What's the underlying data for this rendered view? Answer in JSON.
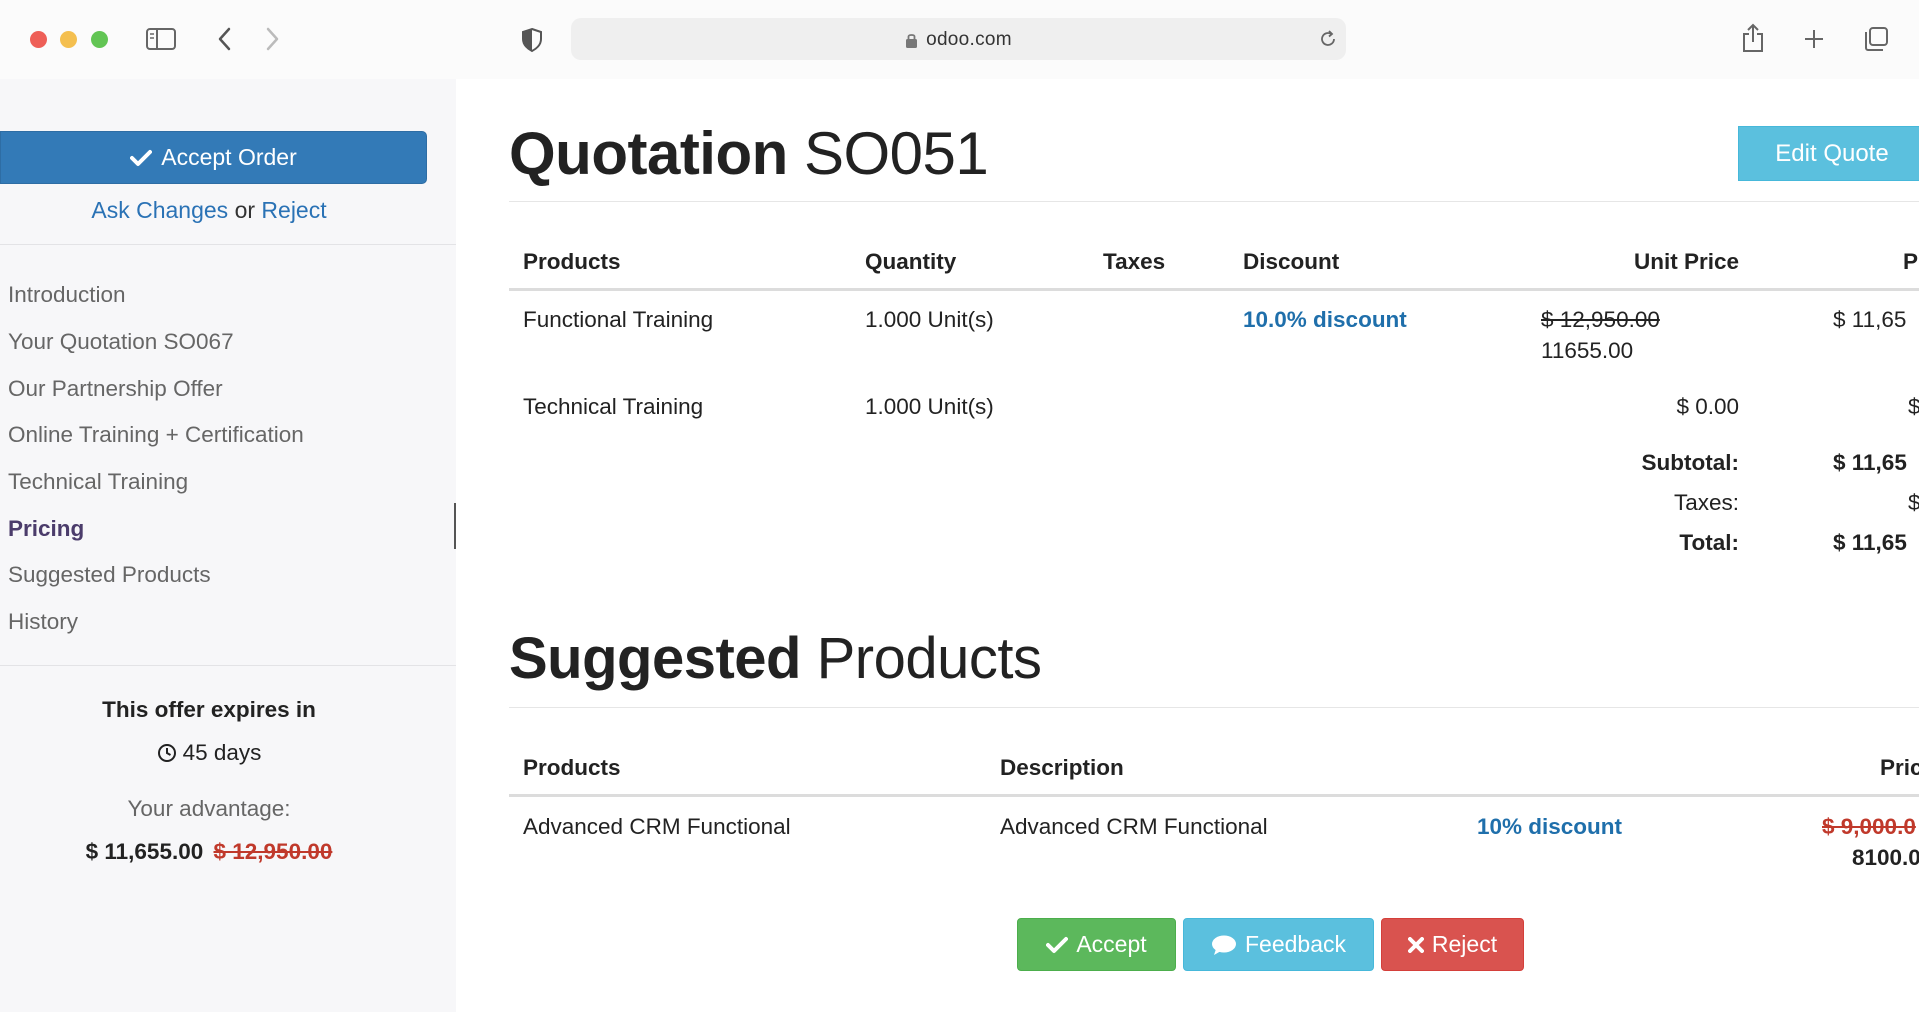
{
  "browser": {
    "url": "odoo.com"
  },
  "sidebar": {
    "accept_order": "Accept Order",
    "ask_changes": "Ask Changes",
    "or": "or",
    "reject": "Reject",
    "nav": [
      {
        "label": "Introduction"
      },
      {
        "label": "Your Quotation SO067"
      },
      {
        "label": "Our Partnership Offer"
      },
      {
        "label": "Online Training + Certification"
      },
      {
        "label": "Technical Training"
      },
      {
        "label": "Pricing"
      },
      {
        "label": "Suggested Products"
      },
      {
        "label": "History"
      }
    ],
    "expires_label": "This offer expires in",
    "days": "45 days",
    "advantage_label": "Your advantage:",
    "advantage_new": "$ 11,655.00",
    "advantage_old": "$ 12,950.00"
  },
  "quotation": {
    "title_bold": "Quotation",
    "title_light": "SO051",
    "edit_button": "Edit Quote",
    "headers": {
      "products": "Products",
      "quantity": "Quantity",
      "taxes": "Taxes",
      "discount": "Discount",
      "unit_price": "Unit Price",
      "price": "P"
    },
    "rows": [
      {
        "product": "Functional Training",
        "quantity": "1.000 Unit(s)",
        "discount": "10.0% discount",
        "unit_price_old": "$ 12,950.00",
        "unit_price": "11655.00",
        "price": "$ 11,65"
      },
      {
        "product": "Technical Training",
        "quantity": "1.000 Unit(s)",
        "unit_price": "$ 0.00",
        "price": "$"
      }
    ],
    "subtotal_label": "Subtotal:",
    "subtotal": "$ 11,65",
    "taxes_label": "Taxes:",
    "taxes": "$",
    "total_label": "Total:",
    "total": "$ 11,65"
  },
  "suggested": {
    "title_bold": "Suggested",
    "title_light": "Products",
    "headers": {
      "products": "Products",
      "description": "Description",
      "price": "Pric"
    },
    "rows": [
      {
        "product": "Advanced CRM Functional",
        "description": "Advanced CRM Functional",
        "discount": "10% discount",
        "price_old": "$ 9,000.0",
        "price": "8100.0"
      }
    ]
  },
  "actions": {
    "accept": "Accept",
    "feedback": "Feedback",
    "reject": "Reject"
  },
  "colors": {
    "primary": "#337ab7",
    "info": "#5bc0de",
    "success": "#5cb85c",
    "danger": "#d9534f",
    "link": "#2a72b5"
  }
}
